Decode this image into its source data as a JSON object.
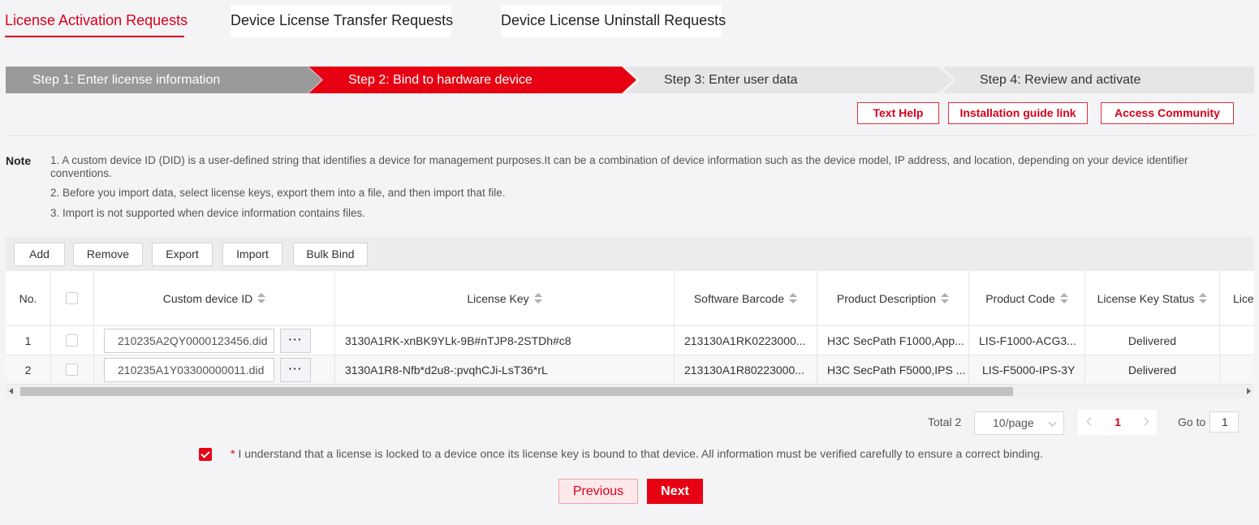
{
  "tabs": [
    {
      "label": "License Activation Requests",
      "active": true
    },
    {
      "label": "Device License Transfer Requests",
      "active": false
    },
    {
      "label": "Device License Uninstall Requests",
      "active": false
    }
  ],
  "steps": [
    {
      "label": "Step 1: Enter license information",
      "state": "done"
    },
    {
      "label": "Step 2: Bind to hardware device",
      "state": "current"
    },
    {
      "label": "Step 3: Enter user data",
      "state": "todo"
    },
    {
      "label": "Step 4: Review and activate",
      "state": "todo"
    }
  ],
  "help_links": {
    "text_help": "Text Help",
    "installation_guide": "Installation guide link",
    "access_community": "Access Community"
  },
  "note": {
    "label": "Note",
    "lines": [
      "1. A custom device ID (DID) is a user-defined string that identifies a device for management purposes.It can be a combination of device information such as the device model, IP address, and location, depending on your device identifier conventions.",
      "2. Before you import data, select license keys, export them into a file, and then import that file.",
      "3. Import is not supported when device information contains files."
    ]
  },
  "toolbar": {
    "add": "Add",
    "remove": "Remove",
    "export": "Export",
    "import": "Import",
    "bulk_bind": "Bulk Bind"
  },
  "table": {
    "columns": {
      "no": "No.",
      "custom_device_id": "Custom device ID",
      "license_key": "License Key",
      "software_barcode": "Software Barcode",
      "product_description": "Product Description",
      "product_code": "Product Code",
      "license_key_status": "License Key Status",
      "license_partial": "Licen"
    },
    "dots_label": "···",
    "rows": [
      {
        "no": "1",
        "custom_device_id": "210235A2QY0000123456.did",
        "license_key": "3130A1RK-xnBK9YLk-9B#nTJP8-2STDh#c8",
        "software_barcode": "213130A1RK0223000...",
        "product_description": "H3C SecPath F1000,App...",
        "product_code": "LIS-F1000-ACG3...",
        "license_key_status": "Delivered"
      },
      {
        "no": "2",
        "custom_device_id": "210235A1Y03300000011.did",
        "license_key": "3130A1R8-Nfb*d2u8-:pvqhCJi-LsT36*rL",
        "software_barcode": "213130A1R80223000...",
        "product_description": "H3C SecPath F5000,IPS ...",
        "product_code": "LIS-F5000-IPS-3Y",
        "license_key_status": "Delivered"
      }
    ]
  },
  "pagination": {
    "total": "Total 2",
    "page_size": "10/page",
    "current_page": "1",
    "goto_label": "Go to",
    "goto_value": "1"
  },
  "agreement": {
    "required_mark": "*",
    "text": "I understand that a license is locked to a device once its license key is bound to that device. All information must be verified carefully to ensure a correct binding.",
    "checked": true
  },
  "buttons": {
    "previous": "Previous",
    "next": "Next"
  },
  "colors": {
    "accent": "#e60012",
    "step_done": "#999999",
    "step_todo": "#e6e6e6"
  }
}
